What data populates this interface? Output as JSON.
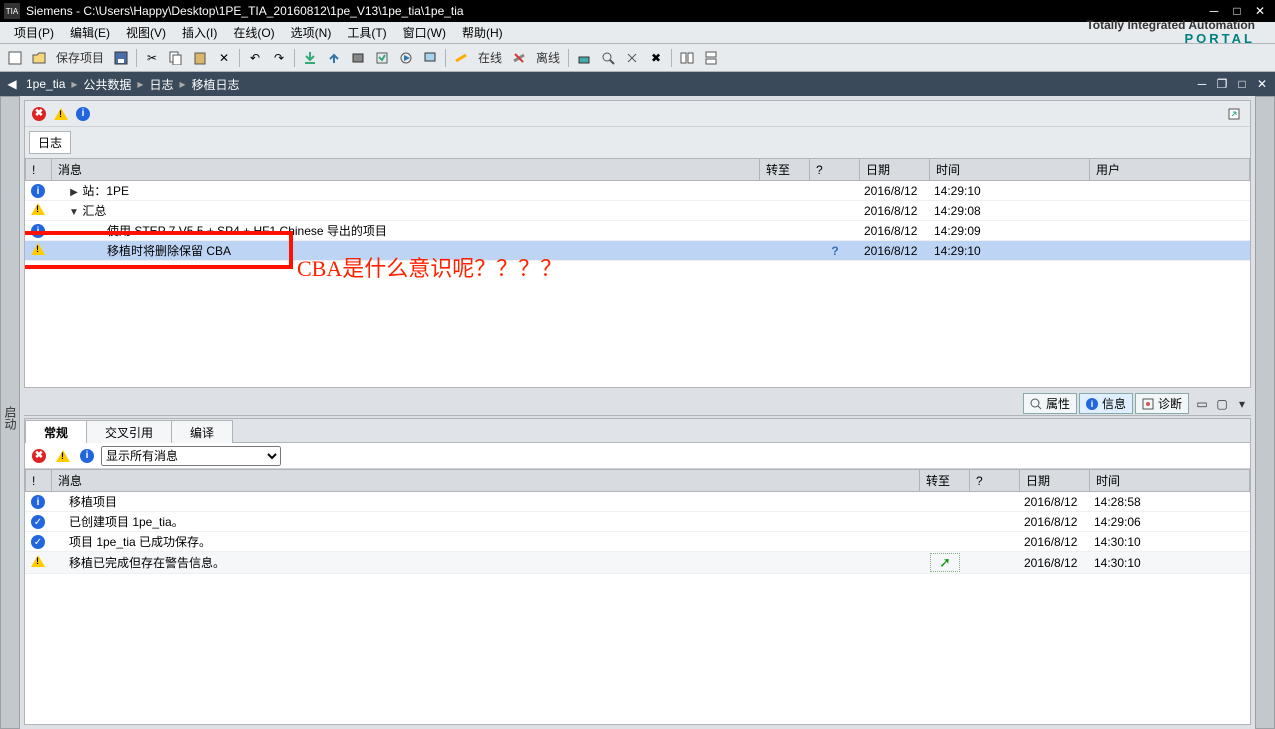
{
  "window_title": "Siemens  -  C:\\Users\\Happy\\Desktop\\1PE_TIA_20160812\\1pe_V13\\1pe_tia\\1pe_tia",
  "brand": {
    "line1": "Totally Integrated Automation",
    "line2": "PORTAL"
  },
  "menu": [
    "项目(P)",
    "编辑(E)",
    "视图(V)",
    "插入(I)",
    "在线(O)",
    "选项(N)",
    "工具(T)",
    "窗口(W)",
    "帮助(H)"
  ],
  "toolbar": {
    "save_label": "保存项目",
    "online_label": "在线",
    "offline_label": "离线"
  },
  "breadcrumb": [
    "1pe_tia",
    "公共数据",
    "日志",
    "移植日志"
  ],
  "side_tab_left": "启动",
  "upper": {
    "log_label": "日志",
    "headers": {
      "icon": "!",
      "msg": "消息",
      "goto": "转至",
      "q": "?",
      "date": "日期",
      "time": "时间",
      "user": "用户"
    },
    "rows": [
      {
        "icon": "info",
        "indent": 1,
        "exp": "▶",
        "msg": "站：1PE",
        "date": "2016/8/12",
        "time": "14:29:10"
      },
      {
        "icon": "warn",
        "indent": 1,
        "exp": "▼",
        "msg": "汇总",
        "date": "2016/8/12",
        "time": "14:29:08"
      },
      {
        "icon": "info",
        "indent": 3,
        "msg": "使用 STEP 7 V5.5 + SP4 + HF1 Chinese 导出的项目",
        "date": "2016/8/12",
        "time": "14:29:09"
      },
      {
        "icon": "warn",
        "indent": 3,
        "msg": "移植时将删除保留 CBA",
        "q": "?",
        "date": "2016/8/12",
        "time": "14:29:10",
        "selected": true
      }
    ]
  },
  "annotation": "CBA是什么意识呢？？？？",
  "mid_tabs": {
    "prop": "属性",
    "info": "信息",
    "diag": "诊断"
  },
  "lower": {
    "tabs": [
      "常规",
      "交叉引用",
      "编译"
    ],
    "dropdown": "显示所有消息",
    "headers": {
      "icon": "!",
      "msg": "消息",
      "goto": "转至",
      "q": "?",
      "date": "日期",
      "time": "时间"
    },
    "rows": [
      {
        "icon": "info",
        "msg": "移植项目",
        "date": "2016/8/12",
        "time": "14:28:58"
      },
      {
        "icon": "check",
        "msg": "已创建项目 1pe_tia。",
        "date": "2016/8/12",
        "time": "14:29:06"
      },
      {
        "icon": "check",
        "msg": "项目 1pe_tia 已成功保存。",
        "date": "2016/8/12",
        "time": "14:30:10"
      },
      {
        "icon": "warn",
        "msg": "移植已完成但存在警告信息。",
        "goto": true,
        "date": "2016/8/12",
        "time": "14:30:10",
        "alt": true
      }
    ]
  }
}
